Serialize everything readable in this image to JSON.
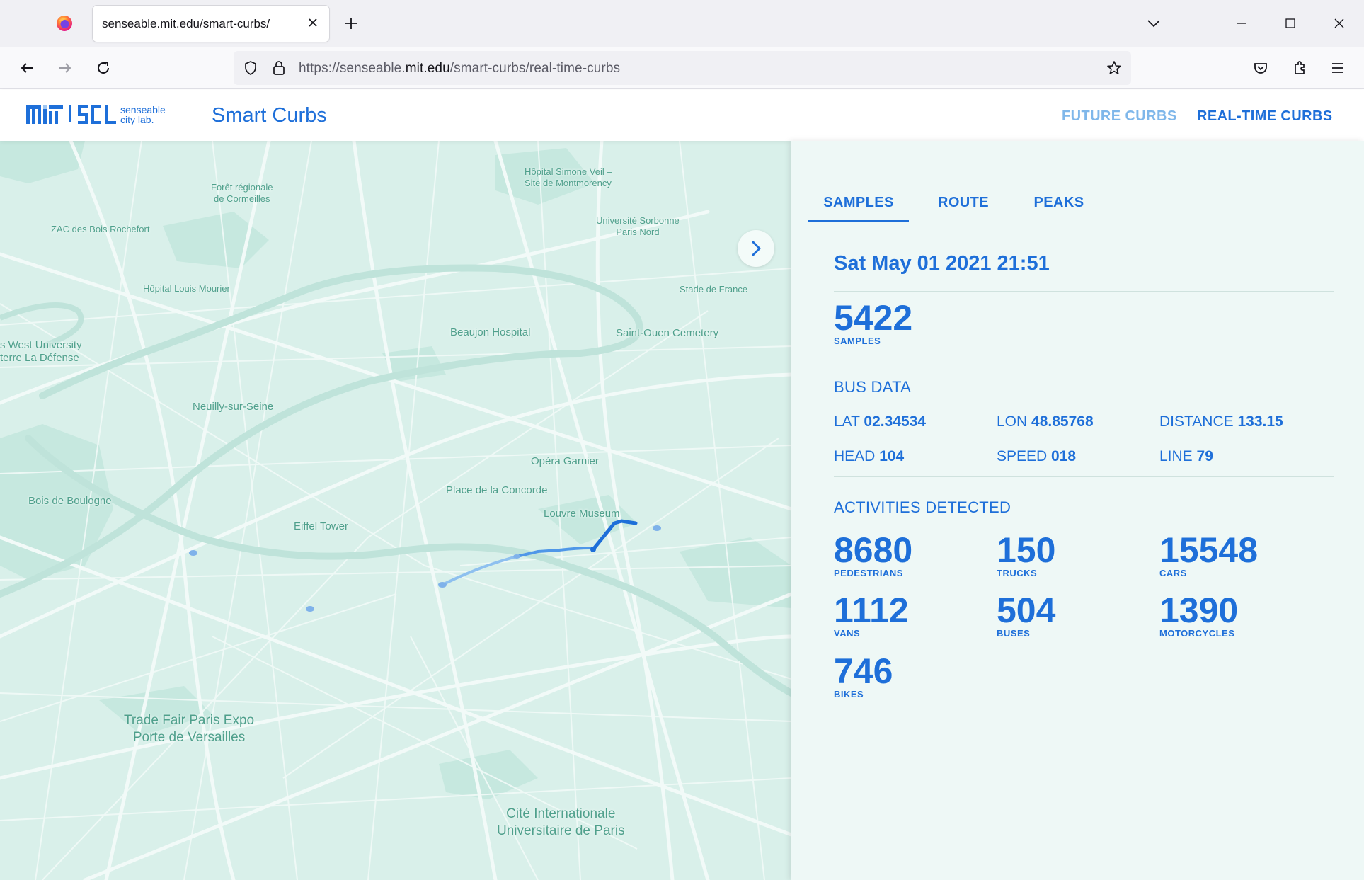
{
  "browser": {
    "tab_title": "senseable.mit.edu/smart-curbs/",
    "url_prefix": "https://senseable.",
    "url_domain": "mit.edu",
    "url_suffix": "/smart-curbs/real-time-curbs"
  },
  "header": {
    "logo_text_line1": "senseable",
    "logo_text_line2": "city lab.",
    "title": "Smart Curbs",
    "nav": [
      {
        "label": "FUTURE CURBS"
      },
      {
        "label": "REAL-TIME CURBS"
      }
    ]
  },
  "map": {
    "labels": [
      "Hôpital Simone Veil –",
      "Site de Montmorency",
      "Forêt régionale",
      "de Cormeilles",
      "Université Sorbonne",
      "Paris Nord",
      "ZAC des Bois Rochefort",
      "Stade de France",
      "Hôpital Louis Mourier",
      "Beaujon Hospital",
      "Saint-Ouen Cemetery",
      "s West University",
      "terre La Défense",
      "Neuilly-sur-Seine",
      "Opéra Garnier",
      "Place de la Concorde",
      "Bois de Boulogne",
      "Louvre Museum",
      "Eiffel Tower",
      "Trade Fair Paris Expo",
      "Porte de Versailles",
      "Cité Internationale",
      "Universitaire de Paris"
    ]
  },
  "panel": {
    "tabs": [
      {
        "label": "SAMPLES"
      },
      {
        "label": "ROUTE"
      },
      {
        "label": "PEAKS"
      }
    ],
    "datetime": "Sat May 01 2021 21:51",
    "samples": {
      "value": "5422",
      "label": "SAMPLES"
    },
    "bus_data": {
      "title": "BUS DATA",
      "lat": {
        "label": "LAT",
        "value": "02.34534"
      },
      "lon": {
        "label": "LON",
        "value": "48.85768"
      },
      "distance": {
        "label": "DISTANCE",
        "value": "133.15"
      },
      "head": {
        "label": "HEAD",
        "value": "104"
      },
      "speed": {
        "label": "SPEED",
        "value": "018"
      },
      "line": {
        "label": "LINE",
        "value": "79"
      }
    },
    "activities": {
      "title": "ACTIVITIES DETECTED",
      "items": [
        {
          "value": "8680",
          "label": "PEDESTRIANS"
        },
        {
          "value": "150",
          "label": "TRUCKS"
        },
        {
          "value": "15548",
          "label": "CARS"
        },
        {
          "value": "1112",
          "label": "VANS"
        },
        {
          "value": "504",
          "label": "BUSES"
        },
        {
          "value": "1390",
          "label": "MOTORCYCLES"
        },
        {
          "value": "746",
          "label": "BIKES"
        }
      ]
    }
  },
  "colors": {
    "accent": "#1e6fd9",
    "accent_light": "#7fb7ea",
    "map_bg": "#d9f0ea",
    "panel_bg": "#eef8f6"
  }
}
